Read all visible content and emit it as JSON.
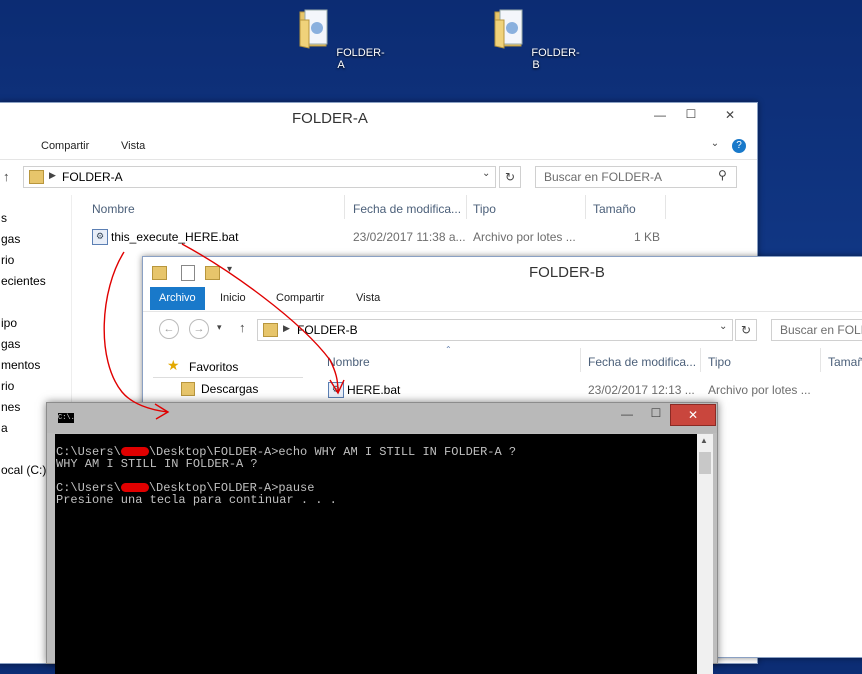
{
  "desktop": {
    "icons": [
      {
        "label": "FOLDER-A",
        "icon": "folder-icon"
      },
      {
        "label": "FOLDER-B",
        "icon": "folder-icon"
      }
    ]
  },
  "folder_a": {
    "title": "FOLDER-A",
    "ribbon": {
      "tabs": [
        "Compartir",
        "Vista"
      ]
    },
    "address": "FOLDER-A",
    "search_placeholder": "Buscar en FOLDER-A",
    "columns": {
      "name": "Nombre",
      "date": "Fecha de modifica...",
      "type": "Tipo",
      "size": "Tamaño"
    },
    "nav_items": [
      "s",
      "gas",
      "rio",
      "ecientes",
      "ipo",
      "gas",
      "mentos",
      "rio",
      "nes",
      "a",
      "ocal (C:)"
    ],
    "files": [
      {
        "name": "this_execute_HERE.bat",
        "date": "23/02/2017 11:38 a...",
        "type": "Archivo por lotes ...",
        "size": "1 KB"
      }
    ],
    "window_buttons": {
      "minimize": "—",
      "maximize": "☐",
      "close": "✕"
    }
  },
  "folder_b": {
    "title": "FOLDER-B",
    "ribbon": {
      "tabs": [
        "Archivo",
        "Inicio",
        "Compartir",
        "Vista"
      ]
    },
    "address": "FOLDER-B",
    "search_placeholder": "Buscar en FOLD",
    "columns": {
      "name": "Nombre",
      "date": "Fecha de modifica...",
      "type": "Tipo",
      "size": "Tamañ"
    },
    "nav_items": [
      "Favoritos",
      "Descargas"
    ],
    "files": [
      {
        "name": "HERE.bat",
        "date": "23/02/2017 12:13 ...",
        "type": "Archivo por lotes ..."
      }
    ]
  },
  "cmd": {
    "icon_label": "C:\\.",
    "lines": [
      {
        "pre": "C:\\Users\\",
        "post": "\\Desktop\\FOLDER-A>echo WHY AM I STILL IN FOLDER-A ?",
        "redacted": true
      },
      {
        "text": "WHY AM I STILL IN FOLDER-A ?"
      },
      {
        "text": ""
      },
      {
        "pre": "C:\\Users\\",
        "post": "\\Desktop\\FOLDER-A>pause",
        "redacted": true
      },
      {
        "text": "Presione una tecla para continuar . . ."
      }
    ],
    "window_buttons": {
      "minimize": "—",
      "maximize": "☐",
      "close": "✕"
    }
  },
  "colors": {
    "accent": "#1979ca",
    "close_red": "#c9463d",
    "annotation_red": "#e00000"
  }
}
